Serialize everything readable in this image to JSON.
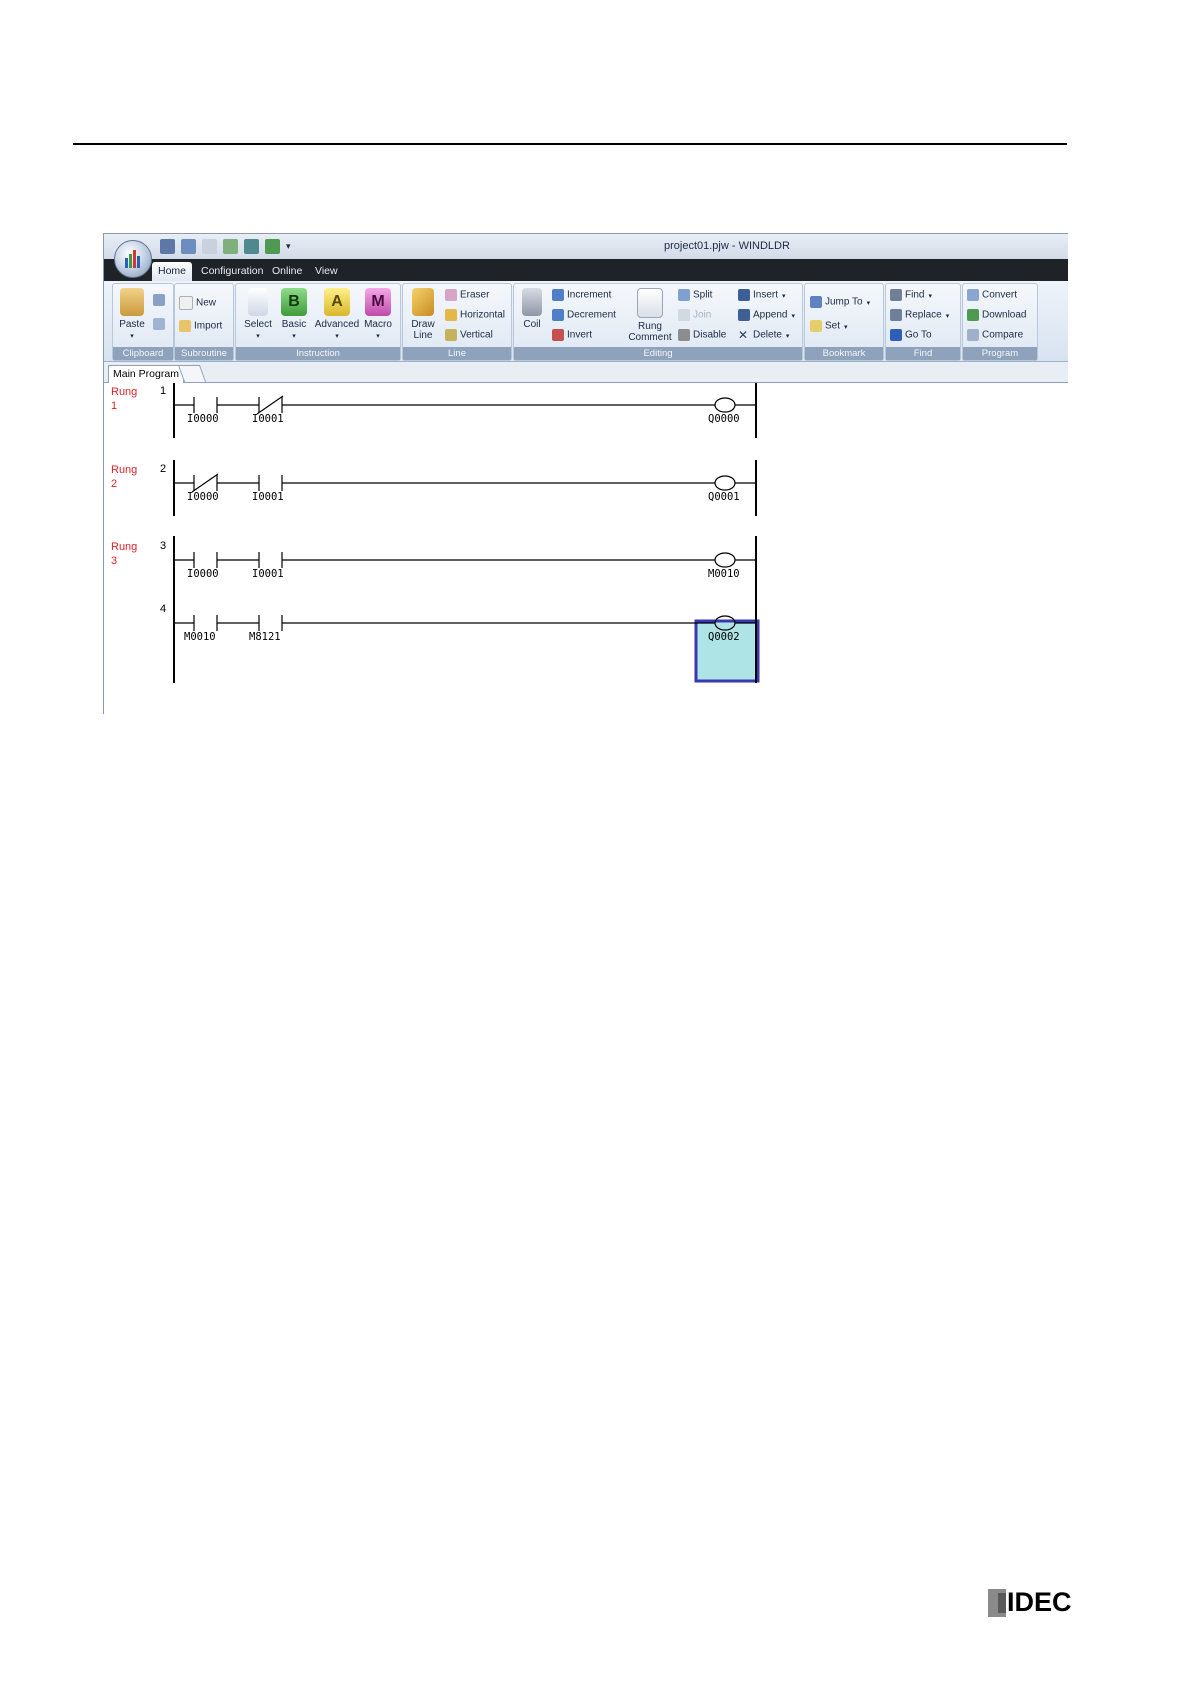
{
  "window": {
    "title": "project01.pjw - WINDLDR"
  },
  "tabs": [
    {
      "label": "Home"
    },
    {
      "label": "Configuration"
    },
    {
      "label": "Online"
    },
    {
      "label": "View"
    }
  ],
  "ribbon": {
    "clipboard": {
      "label": "Clipboard",
      "paste": "Paste"
    },
    "subroutine": {
      "label": "Subroutine",
      "new": "New",
      "import": "Import"
    },
    "instruction": {
      "label": "Instruction",
      "select": "Select",
      "basic": "Basic",
      "advanced": "Advanced",
      "macro": "Macro",
      "basic_letter": "B",
      "advanced_letter": "A",
      "macro_letter": "M"
    },
    "line": {
      "label": "Line",
      "draw_line_1": "Draw",
      "draw_line_2": "Line",
      "eraser": "Eraser",
      "horizontal": "Horizontal",
      "vertical": "Vertical"
    },
    "editing": {
      "label": "Editing",
      "coil": "Coil",
      "increment": "Increment",
      "decrement": "Decrement",
      "invert": "Invert",
      "rung_comment_1": "Rung",
      "rung_comment_2": "Comment",
      "split": "Split",
      "join": "Join",
      "disable": "Disable",
      "insert": "Insert",
      "append": "Append",
      "delete": "Delete"
    },
    "bookmark": {
      "label": "Bookmark",
      "jump_to": "Jump To",
      "set": "Set"
    },
    "find": {
      "label": "Find",
      "find": "Find",
      "replace": "Replace",
      "go_to": "Go To"
    },
    "program": {
      "label": "Program",
      "convert": "Convert",
      "download": "Download",
      "compare": "Compare"
    }
  },
  "program_tab": "Main Program",
  "ladder": {
    "rungs": [
      {
        "label_1": "Rung",
        "label_2": "1",
        "number": "1"
      },
      {
        "label_1": "Rung",
        "label_2": "2",
        "number": "2"
      },
      {
        "label_1": "Rung",
        "label_2": "3",
        "number": "3"
      },
      {
        "label_1": "",
        "label_2": "",
        "number": "4"
      }
    ],
    "operands": {
      "r1c1": "I0000",
      "r1c2": "I0001",
      "r1coil": "Q0000",
      "r2c1": "I0000",
      "r2c2": "I0001",
      "r2coil": "Q0001",
      "r3c1": "I0000",
      "r3c2": "I0001",
      "r3coil": "M0010",
      "r4c1": "M0010",
      "r4c2": "M8121",
      "r4coil": "Q0002"
    }
  },
  "logo": {
    "text": "IDEC"
  },
  "colors": {
    "rung_label": "#e0202a",
    "selection_fill": "#aee4e6",
    "selection_border": "#3a36b0",
    "tab_bar": "#1f2227"
  }
}
